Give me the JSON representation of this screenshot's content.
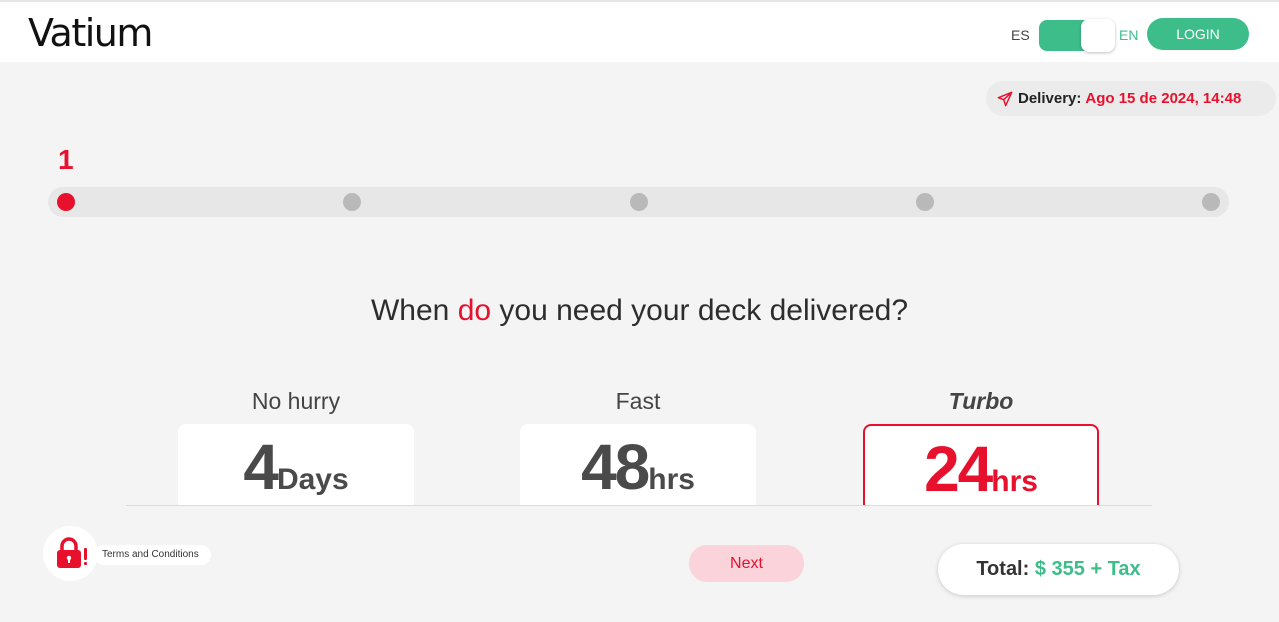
{
  "header": {
    "logo_text": "Vatium",
    "lang_es": "ES",
    "lang_en": "EN",
    "login_label": "LOGIN"
  },
  "delivery": {
    "label": "Delivery:",
    "date": "Ago 15 de 2024, 14:48"
  },
  "progress": {
    "current_step": "1",
    "total_steps": 5
  },
  "question": {
    "before": "When ",
    "accent": "do",
    "after": " you need your deck delivered?"
  },
  "options": [
    {
      "label": "No hurry",
      "value": "4",
      "unit": "Days",
      "selected": false
    },
    {
      "label": "Fast",
      "value": "48",
      "unit": "hrs",
      "selected": false
    },
    {
      "label": "Turbo",
      "value": "24",
      "unit": "hrs",
      "selected": true
    }
  ],
  "footer": {
    "terms_label": "Terms and Conditions",
    "next_label": "Next",
    "total_label": "Total:",
    "total_value": "$ 355 + Tax"
  },
  "colors": {
    "accent": "#e8112d",
    "brand_green": "#3dbd8a"
  },
  "icons": {
    "delivery": "paper-plane-icon",
    "terms": "lock-icon"
  }
}
